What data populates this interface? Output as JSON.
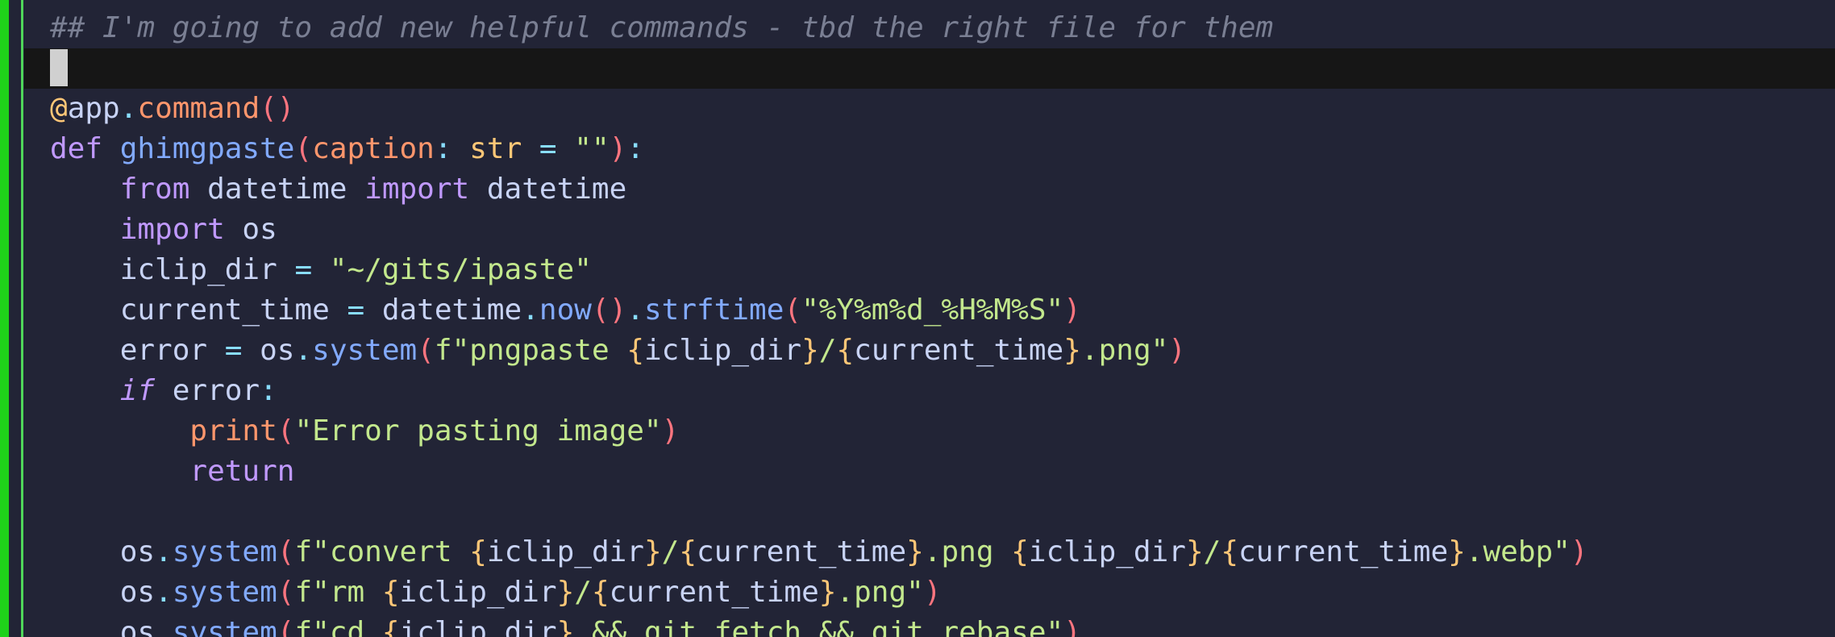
{
  "editor": {
    "lines": [
      {
        "tokens": [
          {
            "t": "## I'm going to add new helpful commands - tbd the right file for them",
            "k": "comment"
          }
        ]
      },
      {
        "cursor": true,
        "tokens": []
      },
      {
        "tokens": [
          {
            "t": "@",
            "k": "dec"
          },
          {
            "t": "app",
            "k": "id"
          },
          {
            "t": ".",
            "k": "punct"
          },
          {
            "t": "command",
            "k": "call"
          },
          {
            "t": "()",
            "k": "paren"
          }
        ]
      },
      {
        "tokens": [
          {
            "t": "def ",
            "k": "kw"
          },
          {
            "t": "ghimgpaste",
            "k": "fn"
          },
          {
            "t": "(",
            "k": "paren"
          },
          {
            "t": "caption",
            "k": "param"
          },
          {
            "t": ": ",
            "k": "punct"
          },
          {
            "t": "str",
            "k": "type"
          },
          {
            "t": " = ",
            "k": "op"
          },
          {
            "t": "\"\"",
            "k": "str"
          },
          {
            "t": ")",
            "k": "paren"
          },
          {
            "t": ":",
            "k": "punct"
          }
        ]
      },
      {
        "tokens": [
          {
            "t": "    ",
            "k": "id"
          },
          {
            "t": "from ",
            "k": "kw"
          },
          {
            "t": "datetime ",
            "k": "id"
          },
          {
            "t": "import ",
            "k": "kw"
          },
          {
            "t": "datetime",
            "k": "id"
          }
        ]
      },
      {
        "tokens": [
          {
            "t": "    ",
            "k": "id"
          },
          {
            "t": "import ",
            "k": "kw"
          },
          {
            "t": "os",
            "k": "id"
          }
        ]
      },
      {
        "tokens": [
          {
            "t": "    iclip_dir ",
            "k": "id"
          },
          {
            "t": "= ",
            "k": "op"
          },
          {
            "t": "\"~/gits/ipaste\"",
            "k": "str"
          }
        ]
      },
      {
        "tokens": [
          {
            "t": "    current_time ",
            "k": "id"
          },
          {
            "t": "= ",
            "k": "op"
          },
          {
            "t": "datetime",
            "k": "id"
          },
          {
            "t": ".",
            "k": "punct"
          },
          {
            "t": "now",
            "k": "method"
          },
          {
            "t": "()",
            "k": "paren"
          },
          {
            "t": ".",
            "k": "punct"
          },
          {
            "t": "strftime",
            "k": "method"
          },
          {
            "t": "(",
            "k": "paren"
          },
          {
            "t": "\"%Y%m%d_%H%M%S\"",
            "k": "str"
          },
          {
            "t": ")",
            "k": "paren"
          }
        ]
      },
      {
        "tokens": [
          {
            "t": "    error ",
            "k": "id"
          },
          {
            "t": "= ",
            "k": "op"
          },
          {
            "t": "os",
            "k": "id"
          },
          {
            "t": ".",
            "k": "punct"
          },
          {
            "t": "system",
            "k": "method"
          },
          {
            "t": "(",
            "k": "paren"
          },
          {
            "t": "f\"pngpaste ",
            "k": "str"
          },
          {
            "t": "{",
            "k": "interp"
          },
          {
            "t": "iclip_dir",
            "k": "id"
          },
          {
            "t": "}",
            "k": "interp"
          },
          {
            "t": "/",
            "k": "str"
          },
          {
            "t": "{",
            "k": "interp"
          },
          {
            "t": "current_time",
            "k": "id"
          },
          {
            "t": "}",
            "k": "interp"
          },
          {
            "t": ".png\"",
            "k": "str"
          },
          {
            "t": ")",
            "k": "paren"
          }
        ]
      },
      {
        "tokens": [
          {
            "t": "    ",
            "k": "id"
          },
          {
            "t": "if",
            "k": "kwi"
          },
          {
            "t": " error",
            "k": "id"
          },
          {
            "t": ":",
            "k": "punct"
          }
        ]
      },
      {
        "tokens": [
          {
            "t": "        ",
            "k": "id"
          },
          {
            "t": "print",
            "k": "builtin"
          },
          {
            "t": "(",
            "k": "paren"
          },
          {
            "t": "\"Error pasting image\"",
            "k": "str"
          },
          {
            "t": ")",
            "k": "paren"
          }
        ]
      },
      {
        "tokens": [
          {
            "t": "        ",
            "k": "id"
          },
          {
            "t": "return",
            "k": "kw"
          }
        ]
      },
      {
        "tokens": []
      },
      {
        "tokens": [
          {
            "t": "    os",
            "k": "id"
          },
          {
            "t": ".",
            "k": "punct"
          },
          {
            "t": "system",
            "k": "method"
          },
          {
            "t": "(",
            "k": "paren"
          },
          {
            "t": "f\"convert ",
            "k": "str"
          },
          {
            "t": "{",
            "k": "interp"
          },
          {
            "t": "iclip_dir",
            "k": "id"
          },
          {
            "t": "}",
            "k": "interp"
          },
          {
            "t": "/",
            "k": "str"
          },
          {
            "t": "{",
            "k": "interp"
          },
          {
            "t": "current_time",
            "k": "id"
          },
          {
            "t": "}",
            "k": "interp"
          },
          {
            "t": ".png ",
            "k": "str"
          },
          {
            "t": "{",
            "k": "interp"
          },
          {
            "t": "iclip_dir",
            "k": "id"
          },
          {
            "t": "}",
            "k": "interp"
          },
          {
            "t": "/",
            "k": "str"
          },
          {
            "t": "{",
            "k": "interp"
          },
          {
            "t": "current_time",
            "k": "id"
          },
          {
            "t": "}",
            "k": "interp"
          },
          {
            "t": ".webp\"",
            "k": "str"
          },
          {
            "t": ")",
            "k": "paren"
          }
        ]
      },
      {
        "tokens": [
          {
            "t": "    os",
            "k": "id"
          },
          {
            "t": ".",
            "k": "punct"
          },
          {
            "t": "system",
            "k": "method"
          },
          {
            "t": "(",
            "k": "paren"
          },
          {
            "t": "f\"rm ",
            "k": "str"
          },
          {
            "t": "{",
            "k": "interp"
          },
          {
            "t": "iclip_dir",
            "k": "id"
          },
          {
            "t": "}",
            "k": "interp"
          },
          {
            "t": "/",
            "k": "str"
          },
          {
            "t": "{",
            "k": "interp"
          },
          {
            "t": "current_time",
            "k": "id"
          },
          {
            "t": "}",
            "k": "interp"
          },
          {
            "t": ".png\"",
            "k": "str"
          },
          {
            "t": ")",
            "k": "paren"
          }
        ]
      },
      {
        "tokens": [
          {
            "t": "    os",
            "k": "id"
          },
          {
            "t": ".",
            "k": "punct"
          },
          {
            "t": "system",
            "k": "method"
          },
          {
            "t": "(",
            "k": "paren"
          },
          {
            "t": "f\"cd ",
            "k": "str"
          },
          {
            "t": "{",
            "k": "interp"
          },
          {
            "t": "iclip_dir",
            "k": "id"
          },
          {
            "t": "}",
            "k": "interp"
          },
          {
            "t": " && git fetch && git rebase\"",
            "k": "str"
          },
          {
            "t": ")",
            "k": "paren"
          }
        ]
      }
    ]
  }
}
